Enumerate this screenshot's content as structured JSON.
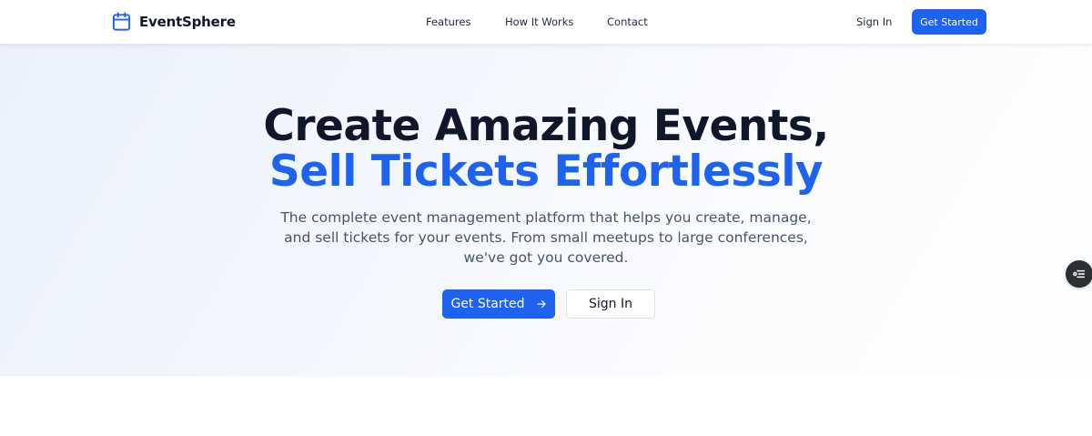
{
  "app": {
    "brand_name": "EventSphere",
    "brand_icon": "calendar-icon",
    "accent_color": "#1d63f0"
  },
  "nav": {
    "links": [
      {
        "label": "Features"
      },
      {
        "label": "How It Works"
      },
      {
        "label": "Contact"
      }
    ],
    "sign_in_label": "Sign In",
    "cta_label": "Get Started"
  },
  "hero": {
    "title_line1": "Create Amazing Events,",
    "title_line2": "Sell Tickets Effortlessly",
    "description": "The complete event management platform that helps you create, manage, and sell tickets for your events. From small meetups to large conferences, we've got you covered.",
    "primary_cta_label": "Get Started",
    "primary_cta_icon": "arrow-right-icon",
    "secondary_cta_label": "Sign In"
  },
  "floating_widget": {
    "icon": "list-settings-icon"
  }
}
